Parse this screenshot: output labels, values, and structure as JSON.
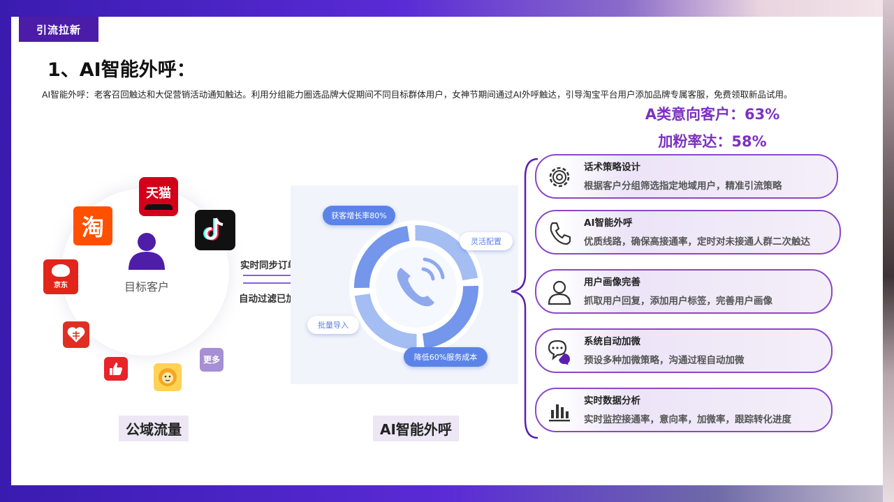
{
  "header": {
    "tag": "引流拉新",
    "title": "1、AI智能外呼：",
    "description": "AI智能外呼：老客召回触达和大促营销活动通知触达。利用分组能力圈选品牌大促期间不同目标群体用户，女神节期间通过AI外呼触达，引导淘宝平台用户添加品牌专属客服，免费领取新品试用。"
  },
  "metrics": {
    "a_class": "A类意向客户：63%",
    "fan_rate": "加粉率达：58%"
  },
  "left": {
    "center_label": "目标客户",
    "bottom_label": "公域流量",
    "apps": {
      "tmall": "天猫",
      "taobao": "淘",
      "jd": "京东",
      "more": "更多"
    }
  },
  "flow": {
    "line1": "实时同步订单手机号",
    "line2": "自动过滤已加手机号"
  },
  "ai": {
    "pill_growth": "获客增长率80%",
    "pill_config": "灵活配置",
    "pill_import": "批量导入",
    "pill_cost": "降低60%服务成本",
    "bottom_label": "AI智能外呼"
  },
  "features": [
    {
      "title": "话术策略设计",
      "desc": "根据客户分组筛选指定地域用户，精准引流策略",
      "icon": "gear-icon"
    },
    {
      "title": "AI智能外呼",
      "desc": "优质线路，确保高接通率，定时对未接通人群二次触达",
      "icon": "phone-icon"
    },
    {
      "title": "用户画像完善",
      "desc": "抓取用户回复，添加用户标签，完善用户画像",
      "icon": "user-icon"
    },
    {
      "title": "系统自动加微",
      "desc": "预设多种加微策略，沟通过程自动加微",
      "icon": "chat-icon"
    },
    {
      "title": "实时数据分析",
      "desc": "实时监控接通率，意向率，加微率，跟踪转化进度",
      "icon": "bar-chart-icon"
    }
  ],
  "colors": {
    "brand_purple": "#4b1ca8",
    "accent_purple": "#8a47c9",
    "ai_blue": "#5c84e8"
  }
}
